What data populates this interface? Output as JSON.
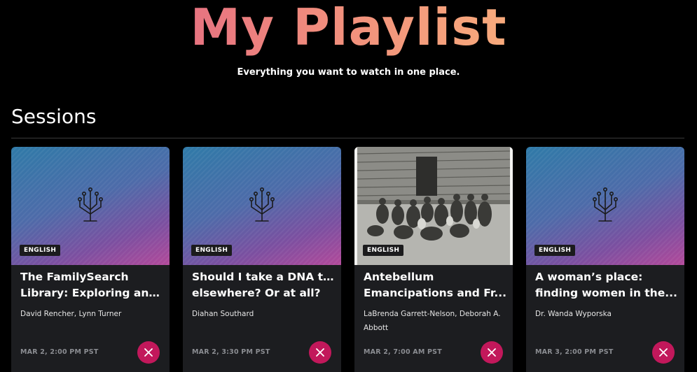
{
  "header": {
    "title": "My Playlist",
    "subtitle": "Everything you want to watch in one place."
  },
  "section": {
    "title": "Sessions"
  },
  "cards": [
    {
      "badge": "ENGLISH",
      "title_lines": [
        "The FamilySearch",
        "Library: Exploring and..."
      ],
      "speakers": "David Rencher, Lynn Turner",
      "date": "MAR 2, 2:00 PM PST",
      "thumbnail": "tree-icon"
    },
    {
      "badge": "ENGLISH",
      "title_lines": [
        "Should I take a DNA test",
        "elsewhere? Or at all?"
      ],
      "speakers": "Diahan Southard",
      "date": "MAR 2, 3:30 PM PST",
      "thumbnail": "tree-icon"
    },
    {
      "badge": "ENGLISH",
      "title_lines": [
        "Antebellum",
        "Emancipations and Fr..."
      ],
      "speakers": "LaBrenda Garrett-Nelson, Deborah A. Abbott",
      "date": "MAR 2, 7:00 AM PST",
      "thumbnail": "historical-photo"
    },
    {
      "badge": "ENGLISH",
      "title_lines": [
        "A woman’s place:",
        "finding women in the..."
      ],
      "speakers": "Dr. Wanda Wyporska",
      "date": "MAR 3, 2:00 PM PST",
      "thumbnail": "tree-icon"
    }
  ],
  "colors": {
    "accent": "#c2185b",
    "title_gradient_start": "#d94f86",
    "title_gradient_end": "#ffc97a",
    "card_bg": "#1c1d20"
  }
}
